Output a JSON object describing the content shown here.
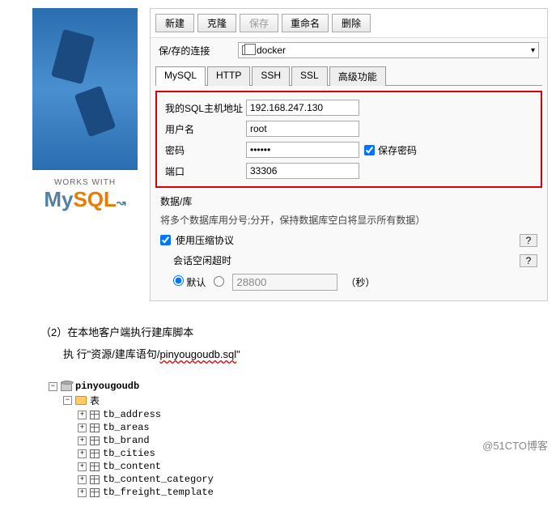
{
  "toolbar": {
    "new": "新建",
    "clone": "克隆",
    "save": "保存",
    "rename": "重命名",
    "delete": "删除"
  },
  "connection": {
    "label": "保/存的连接",
    "value": "docker"
  },
  "tabs": {
    "mysql": "MySQL",
    "http": "HTTP",
    "ssh": "SSH",
    "ssl": "SSL",
    "advanced": "高级功能"
  },
  "form": {
    "host_label": "我的SQL主机地址",
    "host_value": "192.168.247.130",
    "user_label": "用户名",
    "user_value": "root",
    "pass_label": "密码",
    "pass_value": "••••••",
    "save_pass": "保存密码",
    "port_label": "端口",
    "port_value": "33306",
    "db_label": "数据/库",
    "note": "将多个数据库用分号;分开，保持数据库空白将显示所有数据）",
    "compress": "使用压缩协议",
    "timeout_label": "会话空闲超时",
    "default_radio": "默认",
    "timeout_value": "28800",
    "seconds": "（秒）",
    "help": "?"
  },
  "logo": {
    "works": "WORKS WITH",
    "my": "My",
    "sql": "SQL"
  },
  "doc": {
    "step": "（2）在本地客户端执行建库脚本",
    "exec_prefix": "执 行\"资源/建库语句/",
    "filename": "pinyougoudb.sql",
    "exec_suffix": "\""
  },
  "tree": {
    "db": "pinyougoudb",
    "folder": "表",
    "tables": [
      "tb_address",
      "tb_areas",
      "tb_brand",
      "tb_cities",
      "tb_content",
      "tb_content_category",
      "tb_freight_template"
    ]
  },
  "watermark": "@51CTO博客"
}
